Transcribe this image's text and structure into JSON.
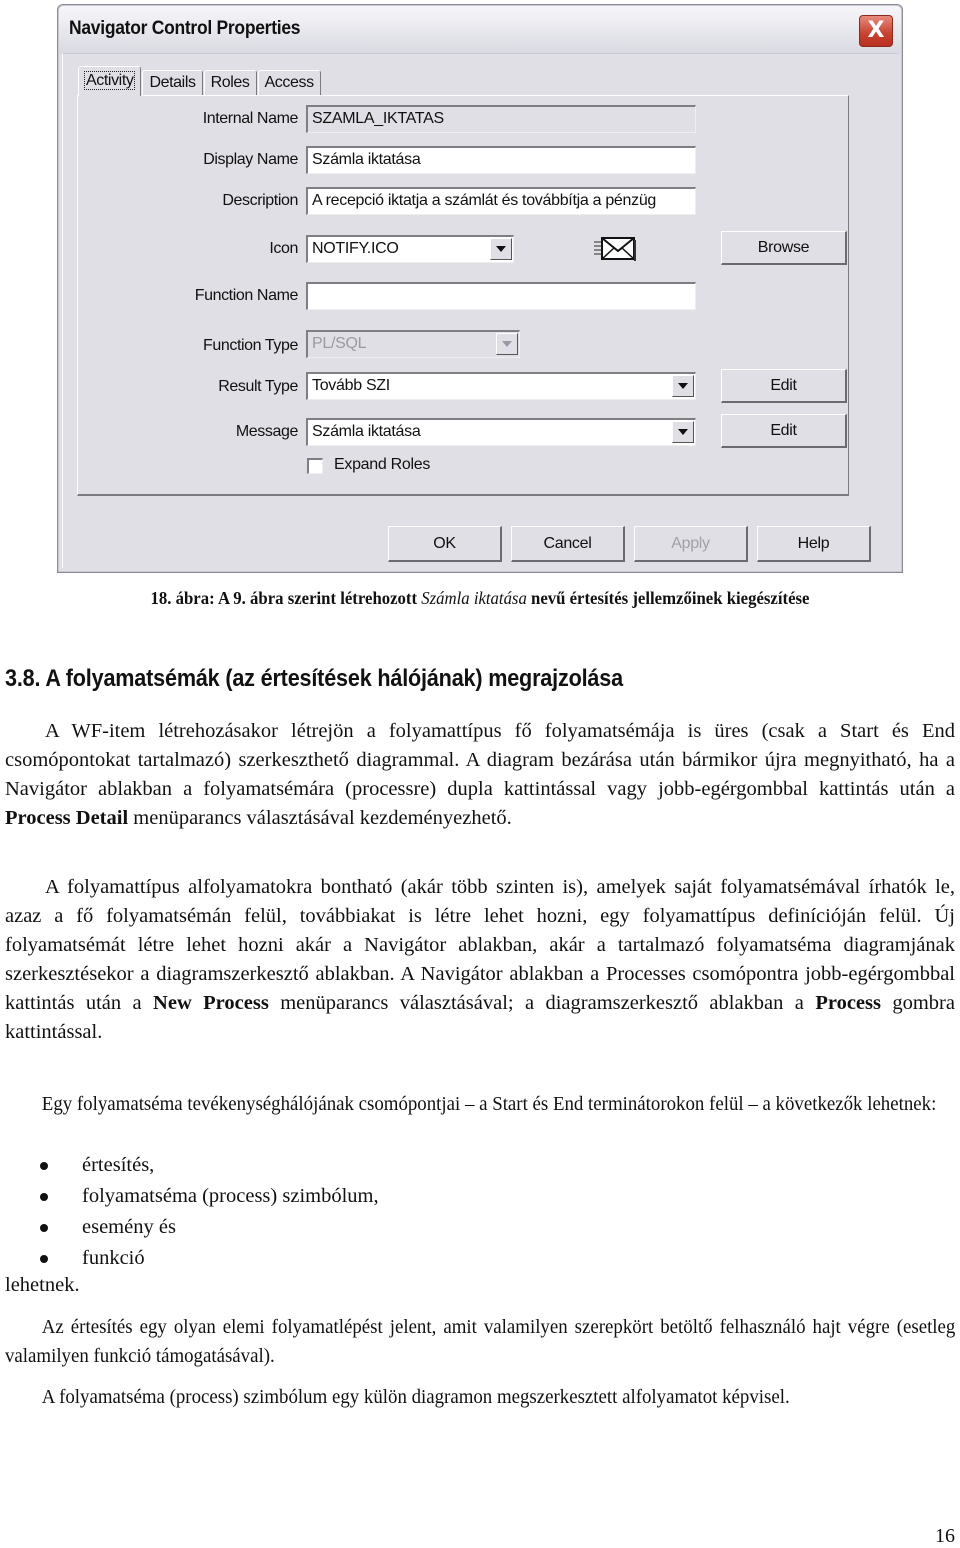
{
  "dialog": {
    "title": "Navigator Control Properties",
    "close_label": "X",
    "tabs": [
      {
        "label": "Activity",
        "active": true
      },
      {
        "label": "Details",
        "active": false
      },
      {
        "label": "Roles",
        "active": false
      },
      {
        "label": "Access",
        "active": false
      }
    ],
    "fields": {
      "internal_name": {
        "label": "Internal Name",
        "value": "SZAMLA_IKTATAS"
      },
      "display_name": {
        "label": "Display Name",
        "value": "Számla iktatása"
      },
      "description": {
        "label": "Description",
        "value": "A recepció iktatja a számlát és továbbítja a pénzüg"
      },
      "icon": {
        "label": "Icon",
        "value": "NOTIFY.ICO",
        "icon_preview": "envelope-icon"
      },
      "function_name": {
        "label": "Function Name",
        "value": ""
      },
      "function_type": {
        "label": "Function Type",
        "value": "PL/SQL"
      },
      "result_type": {
        "label": "Result Type",
        "value": "Tovább SZI"
      },
      "message": {
        "label": "Message",
        "value": "Számla iktatása"
      },
      "expand_roles": {
        "label": "Expand Roles",
        "checked": false
      }
    },
    "side_buttons": {
      "browse": "Browse",
      "edit_result_type": "Edit",
      "edit_message": "Edit"
    },
    "footer_buttons": {
      "ok": "OK",
      "cancel": "Cancel",
      "apply": "Apply",
      "help": "Help"
    }
  },
  "document": {
    "caption": {
      "prefix": "18. ábra: A 9. ábra szerint létrehozott ",
      "italic": "Számla iktatása",
      "suffix": " nevű értesítés jellemzőinek kiegészítése"
    },
    "heading": "3.8. A folyamatsémák (az értesítések hálójának) megrajzolása",
    "paragraph1": {
      "text_before": "A WF-item létrehozásakor létrejön a folyamattípus fő folyamatsémája is üres (csak a Start és End csomópontokat tartalmazó) szerkeszthető diagrammal. A diagram bezárása után bármikor újra megnyitható, ha a Navigátor ablakban a folyamatsémára (processre) dupla kattintással vagy jobb-egérgombbal kattintás után a ",
      "bold": "Process Detail",
      "text_after": " menüparancs választásával kezdeményezhető."
    },
    "paragraph2": {
      "text_before": "A folyamattípus alfolyamatokra bontható (akár több szinten is), amelyek saját folyamatsémával írhatók le, azaz a fő folyamatsémán felül, továbbiakat is létre lehet hozni, egy folyamattípus definícióján felül. Új folyamatsémát létre lehet hozni akár a Navigátor ablakban, akár a tartalmazó folyamatséma diagramjának szerkesztésekor a diagramszerkesztő ablakban. A Navigátor ablakban a Processes csomópontra jobb-egérgombbal kattintás után a ",
      "bold1": "New Process",
      "text_middle": " menüparancs választásával; a diagramszerkesztő ablakban a ",
      "bold2": "Process",
      "text_after": " gombra kattintással."
    },
    "paragraph3": "Egy folyamatséma tevékenységhálójának csomópontjai – a Start és End terminátorokon felül – a következők lehetnek:",
    "bullets": [
      "értesítés,",
      "folyamatséma (process) szimbólum,",
      "esemény és",
      "funkció"
    ],
    "after_bullets": "lehetnek.",
    "paragraph4": "Az értesítés egy olyan elemi folyamatlépést jelent, amit valamilyen szerepkört betöltő felhasználó hajt végre (esetleg valamilyen funkció támogatásával).",
    "paragraph5": "A folyamatséma (process) szimbólum egy külön diagramon megszerkesztett alfolyamatot képvisel.",
    "page_number": "16"
  }
}
